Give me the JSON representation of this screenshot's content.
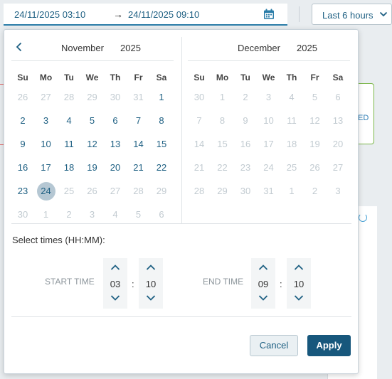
{
  "range": {
    "start": "24/11/2025 03:10",
    "end": "24/11/2025 09:10",
    "icon": "calendar-icon"
  },
  "quick_range": {
    "label": "Last 6 hours"
  },
  "background": {
    "badge_text": "ED"
  },
  "calendar": {
    "dow": [
      "Su",
      "Mo",
      "Tu",
      "We",
      "Th",
      "Fr",
      "Sa"
    ],
    "left": {
      "month": "November",
      "year": "2025",
      "weeks": [
        [
          "26",
          "27",
          "28",
          "29",
          "30",
          "31",
          "1"
        ],
        [
          "2",
          "3",
          "4",
          "5",
          "6",
          "7",
          "8"
        ],
        [
          "9",
          "10",
          "11",
          "12",
          "13",
          "14",
          "15"
        ],
        [
          "16",
          "17",
          "18",
          "19",
          "20",
          "21",
          "22"
        ],
        [
          "23",
          "24",
          "25",
          "26",
          "27",
          "28",
          "29"
        ],
        [
          "30",
          "1",
          "2",
          "3",
          "4",
          "5",
          "6"
        ]
      ],
      "states": [
        [
          "out",
          "out",
          "out",
          "out",
          "out",
          "out",
          "cur"
        ],
        [
          "cur",
          "cur",
          "cur",
          "cur",
          "cur",
          "cur",
          "cur"
        ],
        [
          "cur",
          "cur",
          "cur",
          "cur",
          "cur",
          "cur",
          "cur"
        ],
        [
          "cur",
          "cur",
          "cur",
          "cur",
          "cur",
          "cur",
          "cur"
        ],
        [
          "cur",
          "sel",
          "fut",
          "fut",
          "fut",
          "fut",
          "fut"
        ],
        [
          "fut",
          "fut",
          "fut",
          "fut",
          "fut",
          "fut",
          "fut"
        ]
      ]
    },
    "right": {
      "month": "December",
      "year": "2025",
      "weeks": [
        [
          "30",
          "1",
          "2",
          "3",
          "4",
          "5",
          "6"
        ],
        [
          "7",
          "8",
          "9",
          "10",
          "11",
          "12",
          "13"
        ],
        [
          "14",
          "15",
          "16",
          "17",
          "18",
          "19",
          "20"
        ],
        [
          "21",
          "22",
          "23",
          "24",
          "25",
          "26",
          "27"
        ],
        [
          "28",
          "29",
          "30",
          "31",
          "1",
          "2",
          "3"
        ]
      ]
    },
    "selected_day": "24"
  },
  "times": {
    "title": "Select times (HH:MM):",
    "start_label": "START TIME",
    "end_label": "END TIME",
    "start_hour": "03",
    "start_minute": "10",
    "end_hour": "09",
    "end_minute": "10",
    "separator": ":"
  },
  "buttons": {
    "cancel": "Cancel",
    "apply": "Apply"
  },
  "colors": {
    "accent": "#17577c",
    "link": "#1d5f82",
    "selected_day_bg": "#b5c7d3",
    "muted_day": "#c2cbd1"
  }
}
